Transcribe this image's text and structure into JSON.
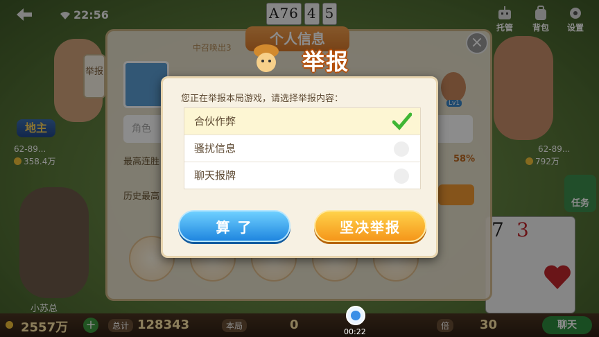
{
  "status_bar": {
    "time": "22:56"
  },
  "table_cards": [
    "A76",
    "4",
    "5"
  ],
  "top_buttons": [
    {
      "label": "托管"
    },
    {
      "label": "背包"
    },
    {
      "label": "设置"
    }
  ],
  "left_player": {
    "role": "地主",
    "id": "62-89...",
    "coins": "358.4万"
  },
  "right_player": {
    "id": "62-89...",
    "coins": "792万",
    "task": "任务"
  },
  "self_player": {
    "name": "小苏总"
  },
  "bottom_bar": {
    "coins": "2557万",
    "total_label": "总计",
    "total": "128343",
    "round_label": "本局",
    "round_value": "0",
    "multiplier_label": "倍",
    "multiplier": "30",
    "chat_label": "聊天"
  },
  "hand_cards": [
    "7",
    "3"
  ],
  "profile": {
    "title": "个人信息",
    "report_side": "举报",
    "role_placeholder": "角色",
    "label_win_streak": "最高连胜",
    "label_history": "历史最高",
    "win_rate": "58%",
    "level": "Lv1",
    "banner": "中召唤出3"
  },
  "report_dialog": {
    "title": "举报",
    "prompt": "您正在举报本局游戏，请选择举报内容：",
    "options": [
      {
        "label": "合伙作弊",
        "selected": true
      },
      {
        "label": "骚扰信息",
        "selected": false
      },
      {
        "label": "聊天报牌",
        "selected": false
      }
    ],
    "cancel_label": "算 了",
    "confirm_label": "坚决举报"
  },
  "recording": {
    "time": "00:22"
  }
}
